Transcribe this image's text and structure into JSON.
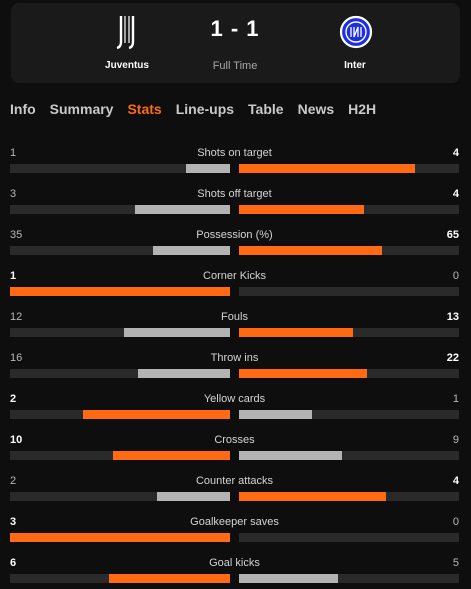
{
  "match": {
    "home_team": "Juventus",
    "away_team": "Inter",
    "home_score": "1",
    "away_score": "1",
    "score_separator": " - ",
    "status": "Full Time"
  },
  "tabs": [
    {
      "label": "Info",
      "active": false
    },
    {
      "label": "Summary",
      "active": false
    },
    {
      "label": "Stats",
      "active": true
    },
    {
      "label": "Line-ups",
      "active": false
    },
    {
      "label": "Table",
      "active": false
    },
    {
      "label": "News",
      "active": false
    },
    {
      "label": "H2H",
      "active": false
    }
  ],
  "colors": {
    "accent": "#ff6a13",
    "loser_bar": "#b3b3b3",
    "track": "#2a2a2a",
    "background": "#0e0e0e"
  },
  "stats": [
    {
      "label": "Shots on target",
      "home": "1",
      "away": "4",
      "home_fill": 0.2,
      "away_fill": 0.8
    },
    {
      "label": "Shots off target",
      "home": "3",
      "away": "4",
      "home_fill": 0.43,
      "away_fill": 0.57
    },
    {
      "label": "Possession (%)",
      "home": "35",
      "away": "65",
      "home_fill": 0.35,
      "away_fill": 0.65
    },
    {
      "label": "Corner Kicks",
      "home": "1",
      "away": "0",
      "home_fill": 1.0,
      "away_fill": 0.0
    },
    {
      "label": "Fouls",
      "home": "12",
      "away": "13",
      "home_fill": 0.48,
      "away_fill": 0.52
    },
    {
      "label": "Throw ins",
      "home": "16",
      "away": "22",
      "home_fill": 0.42,
      "away_fill": 0.58
    },
    {
      "label": "Yellow cards",
      "home": "2",
      "away": "1",
      "home_fill": 0.67,
      "away_fill": 0.33
    },
    {
      "label": "Crosses",
      "home": "10",
      "away": "9",
      "home_fill": 0.53,
      "away_fill": 0.47
    },
    {
      "label": "Counter attacks",
      "home": "2",
      "away": "4",
      "home_fill": 0.33,
      "away_fill": 0.67
    },
    {
      "label": "Goalkeeper saves",
      "home": "3",
      "away": "0",
      "home_fill": 1.0,
      "away_fill": 0.0
    },
    {
      "label": "Goal kicks",
      "home": "6",
      "away": "5",
      "home_fill": 0.55,
      "away_fill": 0.45
    }
  ]
}
